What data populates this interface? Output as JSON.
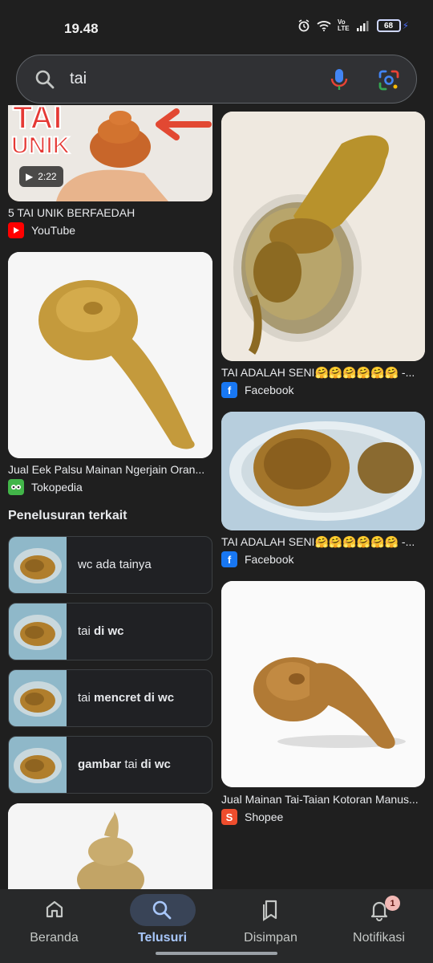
{
  "status": {
    "time": "19.48",
    "battery": "68"
  },
  "search": {
    "query": "tai"
  },
  "results": {
    "left": [
      {
        "title": "5 TAI UNIK BERFAEDAH",
        "source": "YouTube",
        "duration": "2:22",
        "overlay_text_1": "TAI",
        "overlay_text_2": "UNIK"
      },
      {
        "title": "Jual Eek Palsu Mainan Ngerjain Oran...",
        "source": "Tokopedia"
      }
    ],
    "right": [
      {
        "title": "TAI ADALAH SENI🤗🤗🤗🤗🤗🤗 -...",
        "source": "Facebook"
      },
      {
        "title": "TAI ADALAH SENI🤗🤗🤗🤗🤗🤗 -...",
        "source": "Facebook"
      },
      {
        "title": "Jual Mainan Tai-Taian Kotoran Manus...",
        "source": "Shopee"
      }
    ]
  },
  "related": {
    "heading": "Penelusuran terkait",
    "items": [
      {
        "plain1": "wc ada tainya",
        "bold1": "",
        "plain2": "",
        "bold2": ""
      },
      {
        "plain1": "tai ",
        "bold1": "di wc",
        "plain2": "",
        "bold2": ""
      },
      {
        "plain1": "tai ",
        "bold1": "mencret di wc",
        "plain2": "",
        "bold2": ""
      },
      {
        "plain1": "",
        "bold1": "gambar",
        "plain2": " tai ",
        "bold2": "di wc"
      }
    ]
  },
  "nav": {
    "items": [
      {
        "label": "Beranda",
        "icon": "home-icon"
      },
      {
        "label": "Telusuri",
        "icon": "search-icon"
      },
      {
        "label": "Disimpan",
        "icon": "bookmark-icon"
      },
      {
        "label": "Notifikasi",
        "icon": "bell-icon",
        "badge": "1"
      }
    ]
  },
  "colors": {
    "accent": "#a8c7fa",
    "background": "#1f1f1f"
  }
}
